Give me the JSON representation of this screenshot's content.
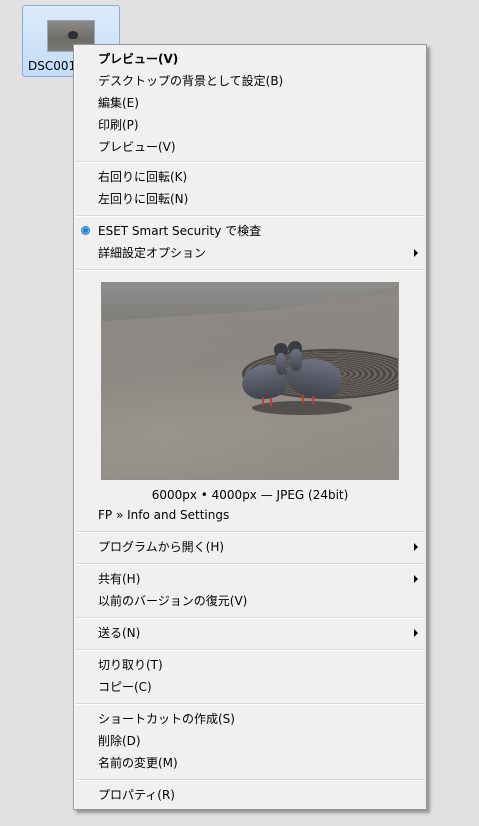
{
  "desktop": {
    "file_label": "DSC001"
  },
  "menu": {
    "group1": [
      "プレビュー(V)",
      "デスクトップの背景として設定(B)",
      "編集(E)",
      "印刷(P)",
      "プレビュー(V)"
    ],
    "group2": [
      "右回りに回転(K)",
      "左回りに回転(N)"
    ],
    "group3": [
      "ESET Smart Security で検査",
      "詳細設定オプション"
    ],
    "image_info": "6000px • 4000px — JPEG (24bit)",
    "fp_item": "FP » Info and Settings",
    "open_with": "プログラムから開く(H)",
    "group5": [
      "共有(H)",
      "以前のバージョンの復元(V)"
    ],
    "send_to": "送る(N)",
    "group7": [
      "切り取り(T)",
      "コピー(C)"
    ],
    "group8": [
      "ショートカットの作成(S)",
      "削除(D)",
      "名前の変更(M)"
    ],
    "properties": "プロパティ(R)"
  },
  "icons": {
    "eset": "radio-icon",
    "submenu": "submenu-arrow-icon"
  },
  "colors": {
    "menu_bg": "#f0f0f0",
    "selection_bg": "#c4dcf6",
    "radio": "#1e7fd6"
  }
}
